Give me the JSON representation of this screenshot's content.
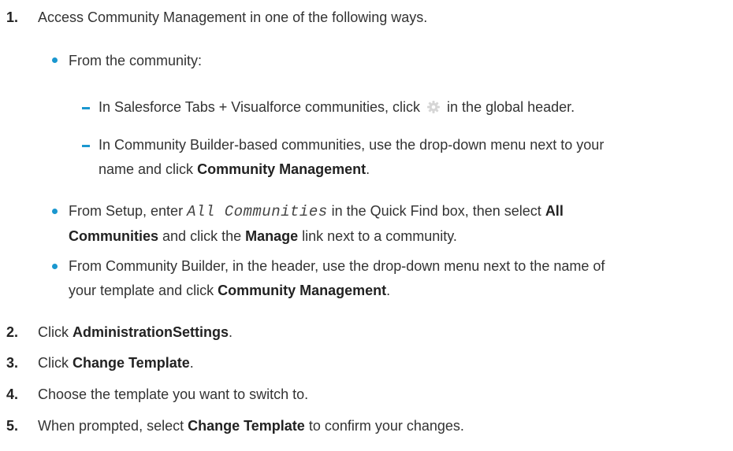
{
  "steps": [
    {
      "number": "1.",
      "text": "Access Community Management in one of the following ways.",
      "options": [
        {
          "text": "From the community:",
          "sub": [
            {
              "pre": "In Salesforce Tabs + Visualforce communities, click",
              "icon": "gear-icon",
              "post": "in the global header."
            },
            {
              "line1": "In Community Builder-based communities, use the drop-down menu next to your",
              "line2_pre": "name and click",
              "line2_bold": "Community Management",
              "line2_post": "."
            }
          ]
        },
        {
          "line1_pre": "From Setup, enter",
          "code": "All Communities",
          "line1_mid": "in the Quick Find box, then select",
          "line1_bold": "All",
          "line2_bold": "Communities",
          "line2_mid": "and click the",
          "line2_bold2": "Manage",
          "line2_post": "link next to a community."
        },
        {
          "line1": "From Community Builder, in the header, use the drop-down menu next to the name of",
          "line2_pre": "your template and click",
          "line2_bold": "Community Management",
          "line2_post": "."
        }
      ]
    },
    {
      "number": "2.",
      "pre": "Click",
      "bold": "AdministrationSettings",
      "post": "."
    },
    {
      "number": "3.",
      "pre": "Click",
      "bold": "Change Template",
      "post": "."
    },
    {
      "number": "4.",
      "text": "Choose the template you want to switch to."
    },
    {
      "number": "5.",
      "pre": "When prompted, select",
      "bold": "Change Template",
      "post": "to confirm your changes."
    }
  ],
  "colors": {
    "bullet": "#1a97cf",
    "text": "#333333",
    "bold": "#222222"
  }
}
